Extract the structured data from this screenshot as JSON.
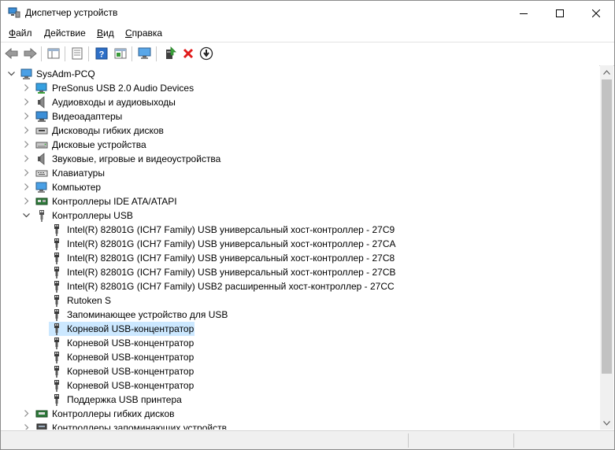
{
  "window": {
    "title": "Диспетчер устройств"
  },
  "menu": [
    {
      "label_ul": "Ф",
      "label_rest": "айл"
    },
    {
      "label_ul": "Д",
      "label_rest": "ействие"
    },
    {
      "label_ul": "В",
      "label_rest": "ид"
    },
    {
      "label_ul": "С",
      "label_rest": "правка"
    }
  ],
  "toolbar": [
    "back-arrow-icon",
    "forward-arrow-icon",
    "show-hide-console-tree-icon",
    "properties-icon",
    "help-icon",
    "action-pane-icon",
    "monitor-scan-icon",
    "update-driver-icon",
    "uninstall-icon",
    "disable-device-icon"
  ],
  "tree": {
    "root": "SysAdm-PCQ",
    "categories_before": [
      {
        "label": "PreSonus USB 2.0 Audio Devices",
        "icon": "monitor-icon"
      },
      {
        "label": "Аудиовходы и аудиовыходы",
        "icon": "speaker-icon"
      },
      {
        "label": "Видеоадаптеры",
        "icon": "display-adapter-icon"
      },
      {
        "label": "Дисководы гибких дисков",
        "icon": "floppy-drive-icon"
      },
      {
        "label": "Дисковые устройства",
        "icon": "disk-drive-icon"
      },
      {
        "label": "Звуковые, игровые и видеоустройства",
        "icon": "speaker-icon"
      },
      {
        "label": "Клавиатуры",
        "icon": "keyboard-icon"
      },
      {
        "label": "Компьютер",
        "icon": "computer-icon"
      },
      {
        "label": "Контроллеры IDE ATA/ATAPI",
        "icon": "ide-controller-icon"
      }
    ],
    "usb_category": "Контроллеры USB",
    "usb_children": [
      "Intel(R) 82801G (ICH7 Family) USB универсальный хост-контроллер  - 27C9",
      "Intel(R) 82801G (ICH7 Family) USB универсальный хост-контроллер  - 27CA",
      "Intel(R) 82801G (ICH7 Family) USB универсальный хост-контроллер - 27C8",
      "Intel(R) 82801G (ICH7 Family) USB универсальный хост-контроллер  - 27CB",
      "Intel(R) 82801G (ICH7 Family) USB2 расширенный хост-контроллер - 27CC",
      "Rutoken S",
      "Запоминающее устройство для USB",
      "Корневой USB-концентратор",
      "Корневой USB-концентратор",
      "Корневой USB-концентратор",
      "Корневой USB-концентратор",
      "Корневой USB-концентратор",
      "Поддержка USB принтера"
    ],
    "selected_child_index": 7,
    "categories_after": [
      {
        "label": "Контроллеры гибких дисков",
        "icon": "floppy-controller-icon"
      },
      {
        "label": "Контроллеры запоминающих устройств",
        "icon": "storage-controller-icon"
      }
    ]
  },
  "colors": {
    "selection": "#cce8ff",
    "scrollbar_thumb": "#c2c2c2",
    "statusbar": "#f0f0f0"
  }
}
